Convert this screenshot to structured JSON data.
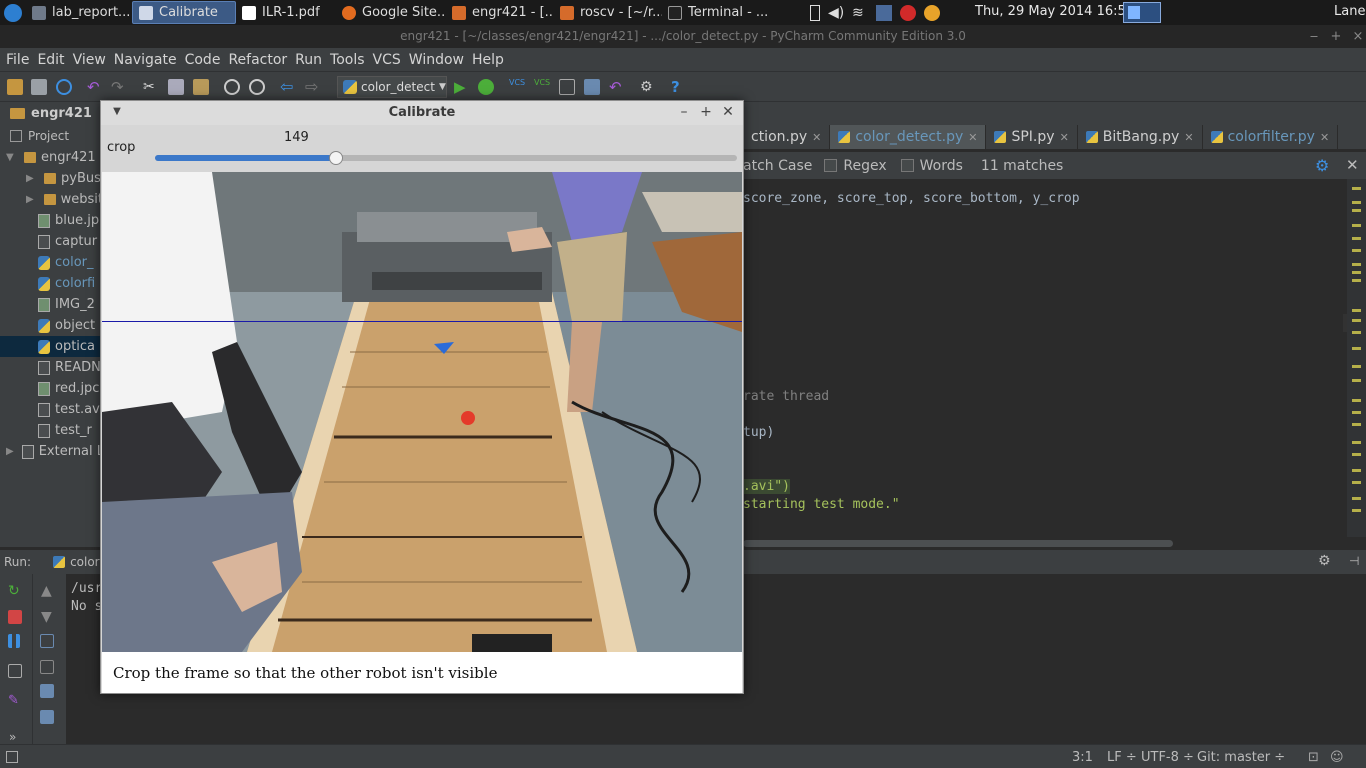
{
  "taskbar": {
    "tasks": [
      "lab_report...",
      "Calibrate",
      "ILR-1.pdf",
      "Google Site...",
      "engr421 - [...",
      "roscv - [~/r...",
      "Terminal - ..."
    ],
    "clock": "Thu, 29 May 2014 16:52",
    "user": "Lane"
  },
  "ide": {
    "window_title": "engr421 - [~/classes/engr421/engr421] - .../color_detect.py - PyCharm Community Edition 3.0",
    "menu": [
      "File",
      "Edit",
      "View",
      "Navigate",
      "Code",
      "Refactor",
      "Run",
      "Tools",
      "VCS",
      "Window",
      "Help"
    ],
    "run_config": "color_detect",
    "nav_crumb": "engr421",
    "project_label": "Project",
    "tree": [
      {
        "label": "engr421",
        "kind": "folder",
        "arrow": "▼"
      },
      {
        "label": "pyBus",
        "kind": "folder",
        "arrow": "▶"
      },
      {
        "label": "websit",
        "kind": "folder",
        "arrow": "▶"
      },
      {
        "label": "blue.jp",
        "kind": "img"
      },
      {
        "label": "captur",
        "kind": "file"
      },
      {
        "label": "color_",
        "kind": "py"
      },
      {
        "label": "colorfi",
        "kind": "py"
      },
      {
        "label": "IMG_2",
        "kind": "img"
      },
      {
        "label": "object",
        "kind": "py"
      },
      {
        "label": "optica",
        "kind": "py"
      },
      {
        "label": "READN",
        "kind": "file"
      },
      {
        "label": "red.jpc",
        "kind": "img"
      },
      {
        "label": "test.av",
        "kind": "file"
      },
      {
        "label": "test_r",
        "kind": "file"
      },
      {
        "label": "External L",
        "kind": "lib",
        "arrow": "▶"
      }
    ],
    "tabs": [
      "ction.py",
      "color_detect.py",
      "SPI.py",
      "BitBang.py",
      "colorfilter.py"
    ],
    "search": {
      "match_case": "atch Case",
      "regex": "Regex",
      "words": "Words",
      "matches": "11 matches"
    },
    "code_lines": [
      {
        "text": "score_zone, score_top, score_bottom, y_crop",
        "kind": "plain"
      },
      {
        "text": "rate thread",
        "kind": "comment"
      },
      {
        "text": "tup)",
        "kind": "plain"
      },
      {
        "text": ".avi\")",
        "kind": "string"
      },
      {
        "text": "starting test mode.\"",
        "kind": "string"
      }
    ],
    "run": {
      "label": "Run:",
      "tab": "colorf",
      "output": [
        "/usr",
        "No s"
      ]
    },
    "status": {
      "position": "3:1",
      "line_sep": "LF ÷",
      "encoding": "UTF-8 ÷",
      "git": "Git: master ÷"
    }
  },
  "dialog": {
    "title": "Calibrate",
    "slider_label": "crop",
    "slider_value": 149,
    "slider_max": 480,
    "caption": "Crop the frame so that the other robot isn't visible"
  },
  "colors": {
    "accent_blue": "#3b78c9",
    "python_string": "#a5c25c",
    "crop_line": "#1a1aa8"
  }
}
